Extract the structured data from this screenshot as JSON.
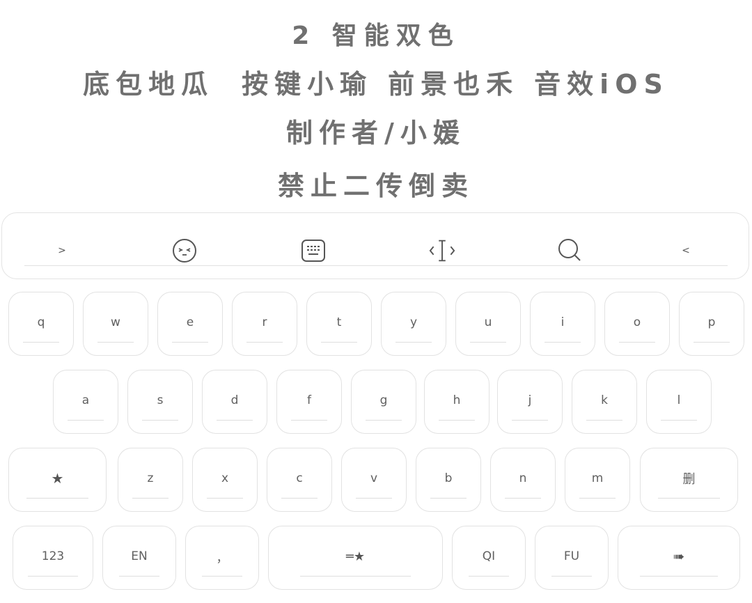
{
  "header": {
    "line1": "2  智能双色",
    "line2_parts": [
      "底包地瓜",
      "按键小瑜",
      "前景也禾",
      "音效iOS"
    ],
    "line3": "制作者/小媛",
    "line4": "禁止二传倒卖"
  },
  "toolbar": {
    "left_arrow": ">",
    "right_arrow": "<",
    "icons": [
      "emoji-icon",
      "keyboard-icon",
      "cursor-move-icon",
      "search-icon"
    ]
  },
  "keys": {
    "row1": [
      "q",
      "w",
      "e",
      "r",
      "t",
      "y",
      "u",
      "i",
      "o",
      "p"
    ],
    "row2": [
      "a",
      "s",
      "d",
      "f",
      "g",
      "h",
      "j",
      "k",
      "l"
    ],
    "row3": {
      "star": "★",
      "letters": [
        "z",
        "x",
        "c",
        "v",
        "b",
        "n",
        "m"
      ],
      "delete": "删"
    },
    "row4": {
      "num": "123",
      "lang": "EN",
      "comma": "，",
      "space": "═★",
      "qi": "QI",
      "fu": "FU",
      "enter": "➠"
    }
  }
}
